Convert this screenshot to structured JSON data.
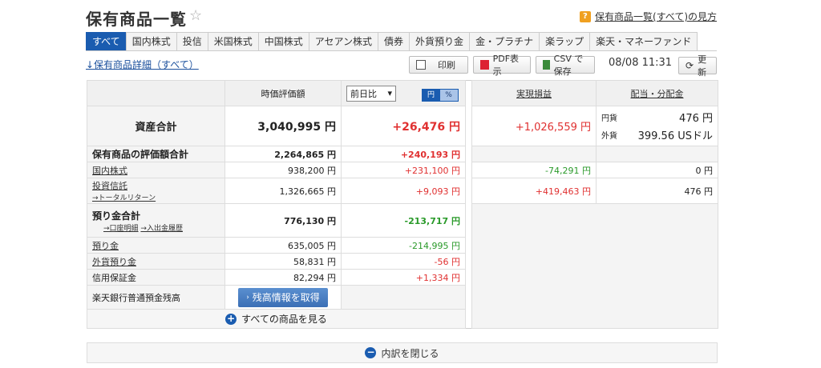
{
  "header": {
    "title": "保有商品一覧",
    "help_icon": "?",
    "help_link": "保有商品一覧(すべて)の見方"
  },
  "tabs": [
    {
      "label": "すべて",
      "active": true
    },
    {
      "label": "国内株式"
    },
    {
      "label": "投信"
    },
    {
      "label": "米国株式"
    },
    {
      "label": "中国株式"
    },
    {
      "label": "アセアン株式"
    },
    {
      "label": "債券"
    },
    {
      "label": "外貨預り金"
    },
    {
      "label": "金・プラチナ"
    },
    {
      "label": "楽ラップ"
    },
    {
      "label": "楽天・マネーファンド"
    }
  ],
  "toolbar": {
    "detail_link": "↓保有商品詳細（すべて）",
    "print_label": "印刷",
    "pdf_label": "PDF表示",
    "csv_label": "CSV で保存",
    "datetime": "08/08 11:31",
    "refresh_label": "更新"
  },
  "table": {
    "headers": {
      "market_value": "時価評価額",
      "compare_select": "前日比",
      "unit_yen": "円",
      "unit_pct": "%",
      "realized": "実現損益",
      "dividends": "配当・分配金"
    },
    "total": {
      "label": "資産合計",
      "value": "3,040,995 円",
      "change": "+26,476 円",
      "realized": "+1,026,559 円",
      "div_yen_label": "円貨",
      "div_yen_value": "476 円",
      "div_fx_label": "外貨",
      "div_fx_value": "399.56 USドル"
    },
    "holdings_total": {
      "label": "保有商品の評価額合計",
      "value": "2,264,865 円",
      "change": "+240,193 円"
    },
    "domestic": {
      "label": "国内株式",
      "value": "938,200 円",
      "change": "+231,100 円",
      "realized": "-74,291 円",
      "dividend": "0 円"
    },
    "funds": {
      "label": "投資信託",
      "sub": "→トータルリターン",
      "value": "1,326,665 円",
      "change": "+9,093 円",
      "realized": "+419,463 円",
      "dividend": "476 円"
    },
    "deposit_total": {
      "label": "預り金合計",
      "link1": "→口座明細",
      "link2": "→入出金履歴",
      "value": "776,130 円",
      "change": "-213,717 円"
    },
    "deposit": {
      "label": "預り金",
      "value": "635,005 円",
      "change": "-214,995 円"
    },
    "fx_deposit": {
      "label": "外貨預り金",
      "value": "58,831 円",
      "change": "-56 円"
    },
    "margin": {
      "label": "信用保証金",
      "value": "82,294 円",
      "change": "+1,334 円"
    },
    "bank": {
      "label": "楽天銀行普通預金残高",
      "button": "残高情報を取得"
    }
  },
  "footer": {
    "show_all": "すべての商品を見る",
    "close": "内訳を閉じる"
  },
  "colors": {
    "accent": "#1a5cb0",
    "positive": "#e03030",
    "negative": "#2a9a2a"
  }
}
